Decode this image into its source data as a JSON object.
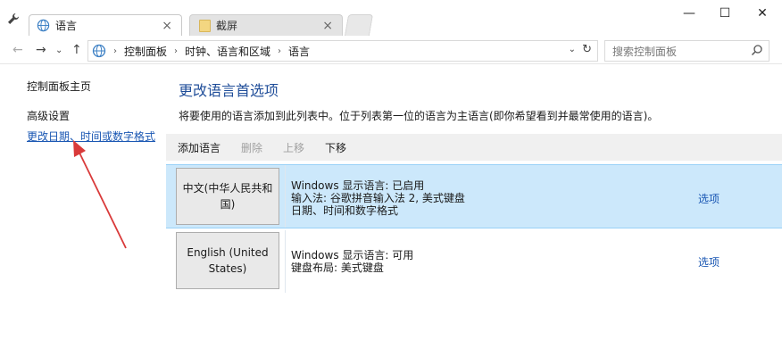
{
  "tabs": [
    {
      "label": "语言",
      "active": true,
      "icon": "globe-icon"
    },
    {
      "label": "截屏",
      "active": false,
      "icon": "folder-icon"
    }
  ],
  "window_controls": {
    "minimize": "—",
    "maximize": "☐",
    "close": "✕"
  },
  "address": {
    "breadcrumbs": [
      "控制面板",
      "时钟、语言和区域",
      "语言"
    ],
    "search_placeholder": "搜索控制面板"
  },
  "sidebar": {
    "home": "控制面板主页",
    "advanced": "高级设置",
    "date_link": "更改日期、时间或数字格式"
  },
  "main": {
    "heading": "更改语言首选项",
    "description": "将要使用的语言添加到此列表中。位于列表第一位的语言为主语言(即你希望看到并最常使用的语言)。",
    "toolbar": {
      "add": "添加语言",
      "remove": "删除",
      "up": "上移",
      "down": "下移"
    },
    "languages": [
      {
        "name": "中文(中华人民共和国)",
        "lines": [
          "Windows 显示语言: 已启用",
          "输入法: 谷歌拼音输入法 2, 美式键盘",
          "日期、时间和数字格式"
        ],
        "options": "选项",
        "selected": true
      },
      {
        "name": "English (United States)",
        "lines": [
          "Windows 显示语言: 可用",
          "键盘布局: 美式键盘"
        ],
        "options": "选项",
        "selected": false
      }
    ]
  },
  "colors": {
    "accent_link": "#1a57b3",
    "selected_row": "#cce8fb",
    "arrow": "#d93a3a"
  }
}
